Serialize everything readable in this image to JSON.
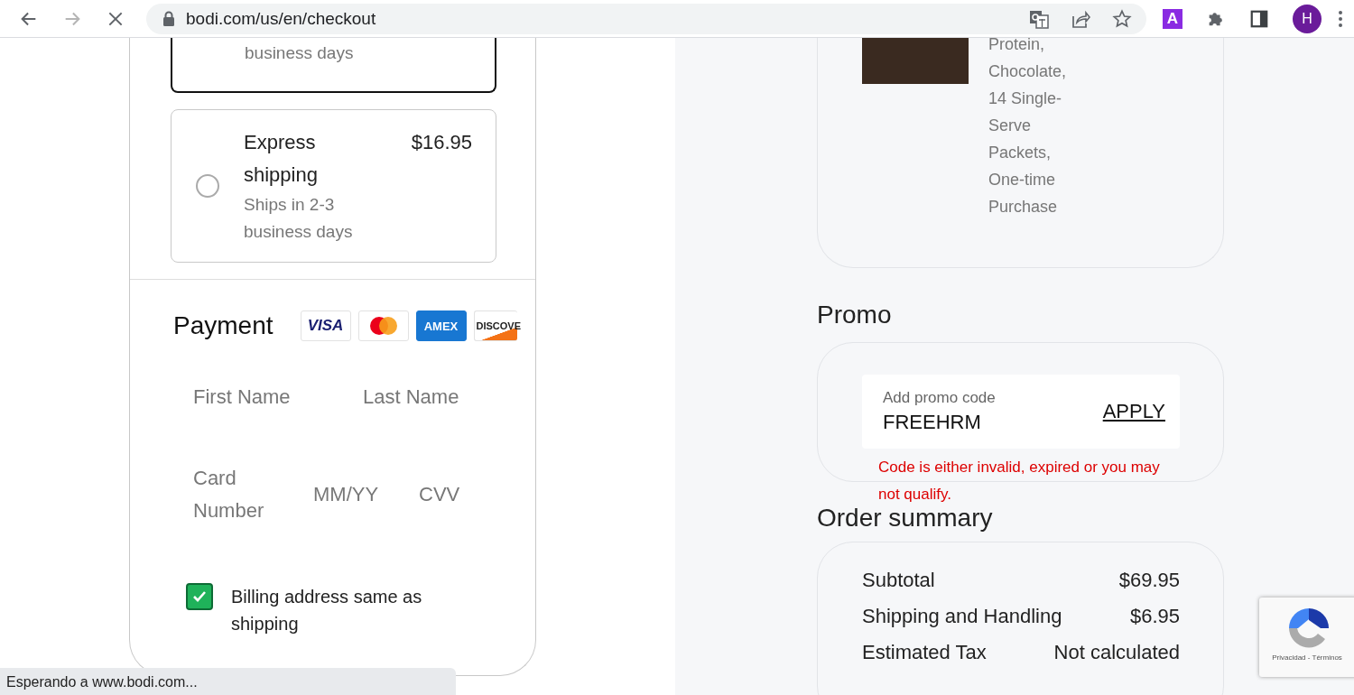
{
  "browser": {
    "back_disabled": false,
    "forward_disabled": true,
    "url": "bodi.com/us/en/checkout",
    "extension_label": "A",
    "avatar_initial": "H"
  },
  "shipping_options": [
    {
      "detail": "business days",
      "selected": true
    },
    {
      "title": "Express shipping",
      "price": "$16.95",
      "detail": "Ships in 2-3 business days",
      "selected": false
    }
  ],
  "payment": {
    "title": "Payment",
    "cards": [
      {
        "kind": "visa",
        "label": "VISA"
      },
      {
        "kind": "mastercard"
      },
      {
        "kind": "amex",
        "label": "AMEX"
      },
      {
        "kind": "discover",
        "label": "DISCOVE"
      }
    ],
    "fields": [
      {
        "placeholder": "First Name"
      },
      {
        "placeholder": "Last Name"
      },
      {
        "placeholder": "Card Number"
      },
      {
        "placeholder": "MM/YY"
      },
      {
        "placeholder": "CVV"
      }
    ],
    "billing_same": {
      "label": "Billing address same as shipping",
      "checked": true
    }
  },
  "product": {
    "description": "Protein, Chocolate, 14 Single-Serve Packets, One-time Purchase"
  },
  "promo": {
    "title": "Promo",
    "label": "Add promo code",
    "value": "FREEHRM",
    "action": "APPLY",
    "error": "Code is either invalid, expired or you may not qualify."
  },
  "order_summary": {
    "title": "Order summary",
    "rows": [
      {
        "label": "Subtotal",
        "value": "$69.95"
      },
      {
        "label": "Shipping and Handling",
        "value": "$6.95"
      },
      {
        "label": "Estimated Tax",
        "value": "Not calculated"
      }
    ]
  },
  "recaptcha": {
    "links": "Privacidad - Términos"
  },
  "status_bar": "Esperando a www.bodi.com..."
}
